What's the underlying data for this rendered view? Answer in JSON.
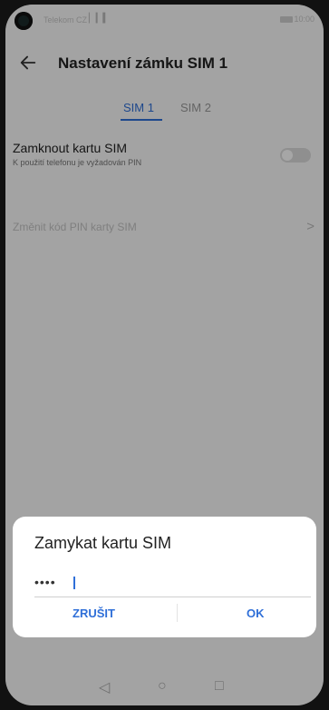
{
  "status_bar": {
    "carrier": "Telekom CZ",
    "signal": "▏▎▍",
    "time": "10:00"
  },
  "app_bar": {
    "title": "Nastavení zámku SIM 1",
    "back_icon": "arrow-back-icon"
  },
  "tabs": [
    {
      "label": "SIM 1",
      "selected": true
    },
    {
      "label": "SIM 2",
      "selected": false
    }
  ],
  "settings": {
    "lock_sim": {
      "title": "Zamknout kartu SIM",
      "subtitle": "K použití telefonu je vyžadován PIN",
      "toggle_on": false
    },
    "change_pin": {
      "label": "Změnit kód PIN karty SIM"
    }
  },
  "dialog": {
    "title": "Zamykat kartu SIM",
    "input_value": "••••",
    "cancel_label": "ZRUŠIT",
    "ok_label": "OK"
  },
  "nav_bar": {
    "back": "◁",
    "home": "○",
    "recent": "□"
  },
  "colors": {
    "accent": "#2f6fd8",
    "background": "#fafafa",
    "scrim": "rgba(0,0,0,0.35)"
  }
}
